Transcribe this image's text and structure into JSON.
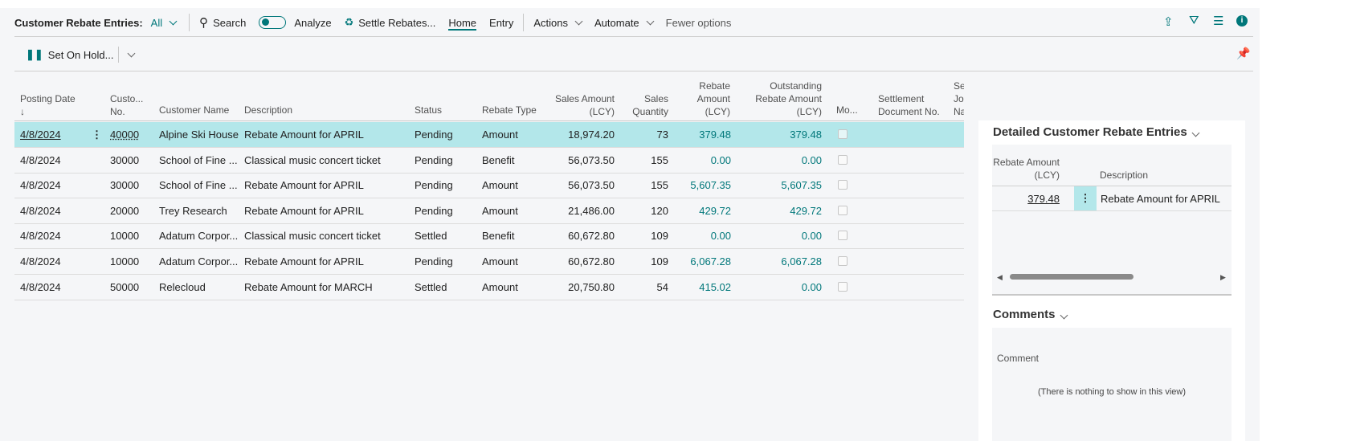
{
  "toolbar": {
    "title": "Customer Rebate Entries:",
    "view": "All",
    "search": "Search",
    "analyze": "Analyze",
    "settle": "Settle Rebates...",
    "home": "Home",
    "entry": "Entry",
    "actions": "Actions",
    "automate": "Automate",
    "fewer": "Fewer options"
  },
  "subbar": {
    "set_on_hold": "Set On Hold..."
  },
  "columns": {
    "posting_date": "Posting Date",
    "sort": "↓",
    "cust_no_1": "Custo...",
    "cust_no_2": "No.",
    "name": "Customer Name",
    "desc": "Description",
    "status": "Status",
    "type": "Rebate Type",
    "sales_1": "Sales Amount",
    "sales_2": "(LCY)",
    "qty_1": "Sales",
    "qty_2": "Quantity",
    "reb_1": "Rebate",
    "reb_2": "Amount",
    "reb_3": "(LCY)",
    "out_1": "Outstanding",
    "out_2": "Rebate Amount",
    "out_3": "(LCY)",
    "mo": "Mo...",
    "sd_1": "Settlement",
    "sd_2": "Document No.",
    "sj_1": "Se",
    "sj_2": "Jo",
    "sj_3": "Na"
  },
  "rows": [
    {
      "date": "4/8/2024",
      "no": "40000",
      "name": "Alpine Ski House",
      "desc": "Rebate Amount for APRIL",
      "status": "Pending",
      "type": "Amount",
      "sales": "18,974.20",
      "qty": "73",
      "rebate": "379.48",
      "outstanding": "379.48"
    },
    {
      "date": "4/8/2024",
      "no": "30000",
      "name": "School of Fine ...",
      "desc": "Classical music concert ticket",
      "status": "Pending",
      "type": "Benefit",
      "sales": "56,073.50",
      "qty": "155",
      "rebate": "0.00",
      "outstanding": "0.00"
    },
    {
      "date": "4/8/2024",
      "no": "30000",
      "name": "School of Fine ...",
      "desc": "Rebate Amount for APRIL",
      "status": "Pending",
      "type": "Amount",
      "sales": "56,073.50",
      "qty": "155",
      "rebate": "5,607.35",
      "outstanding": "5,607.35"
    },
    {
      "date": "4/8/2024",
      "no": "20000",
      "name": "Trey Research",
      "desc": "Rebate Amount for APRIL",
      "status": "Pending",
      "type": "Amount",
      "sales": "21,486.00",
      "qty": "120",
      "rebate": "429.72",
      "outstanding": "429.72"
    },
    {
      "date": "4/8/2024",
      "no": "10000",
      "name": "Adatum Corpor...",
      "desc": "Classical music concert ticket",
      "status": "Settled",
      "type": "Benefit",
      "sales": "60,672.80",
      "qty": "109",
      "rebate": "0.00",
      "outstanding": "0.00"
    },
    {
      "date": "4/8/2024",
      "no": "10000",
      "name": "Adatum Corpor...",
      "desc": "Rebate Amount for APRIL",
      "status": "Pending",
      "type": "Amount",
      "sales": "60,672.80",
      "qty": "109",
      "rebate": "6,067.28",
      "outstanding": "6,067.28"
    },
    {
      "date": "4/8/2024",
      "no": "50000",
      "name": "Relecloud",
      "desc": "Rebate Amount for MARCH",
      "status": "Settled",
      "type": "Amount",
      "sales": "20,750.80",
      "qty": "54",
      "rebate": "415.02",
      "outstanding": "0.00"
    }
  ],
  "factbox": {
    "detail_title": "Detailed Customer Rebate Entries",
    "col_amt_1": "Rebate Amount",
    "col_amt_2": "(LCY)",
    "col_desc": "Description",
    "detail_amount": "379.48",
    "detail_desc": "Rebate Amount for APRIL",
    "comments_title": "Comments",
    "comment_col": "Comment",
    "empty": "(There is nothing to show in this view)"
  },
  "colors": {
    "accent": "#00777a",
    "selected_row": "#b3e7ea"
  }
}
